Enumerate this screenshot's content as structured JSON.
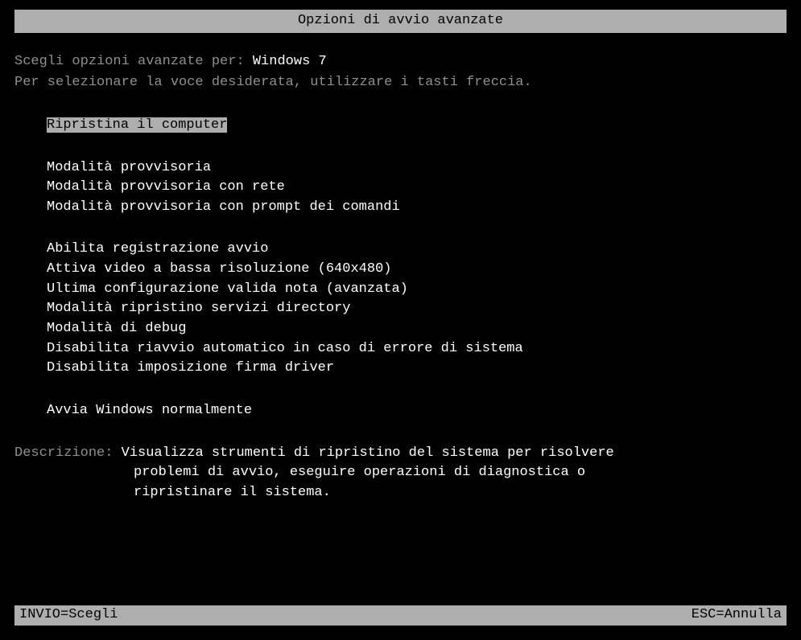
{
  "title": "Opzioni di avvio avanzate",
  "prompt": {
    "prefix": "Scegli opzioni avanzate per: ",
    "os": "Windows 7",
    "instruction": "Per selezionare la voce desiderata, utilizzare i tasti freccia."
  },
  "options": {
    "selected": "Ripristina il computer",
    "group1": [
      "Modalità provvisoria",
      "Modalità provvisoria con rete",
      "Modalità provvisoria con prompt dei comandi"
    ],
    "group2": [
      "Abilita registrazione avvio",
      "Attiva video a bassa risoluzione (640x480)",
      "Ultima configurazione valida nota (avanzata)",
      "Modalità ripristino servizi directory",
      "Modalità di debug",
      "Disabilita riavvio automatico in caso di errore di sistema",
      "Disabilita imposizione firma driver"
    ],
    "group3": [
      "Avvia Windows normalmente"
    ]
  },
  "description": {
    "label": "Descrizione: ",
    "line1": "Visualizza strumenti di ripristino del sistema per risolvere",
    "line2": "problemi di avvio, eseguire operazioni di diagnostica o",
    "line3": "ripristinare il sistema."
  },
  "footer": {
    "left": "INVIO=Scegli",
    "right": "ESC=Annulla"
  }
}
